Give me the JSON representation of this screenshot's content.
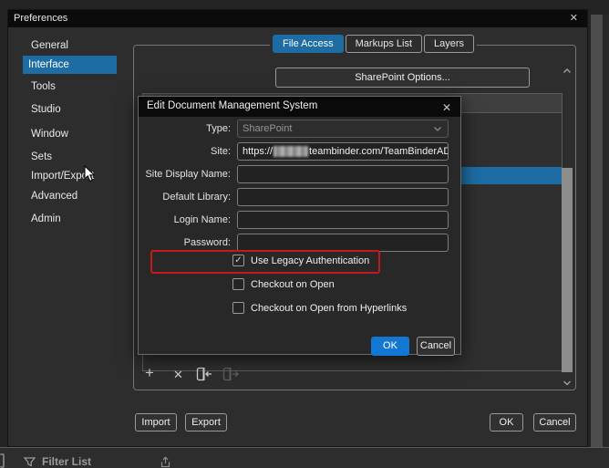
{
  "background_app": {
    "filter_list_label": "Filter List"
  },
  "window": {
    "title": "Preferences",
    "close_glyph": "✕"
  },
  "sidebar": {
    "selected": "Interface",
    "items": [
      "General",
      "Interface",
      "Tools",
      "Studio",
      "Window",
      "Sets",
      "Import/Export",
      "Advanced",
      "Admin"
    ]
  },
  "tabs": {
    "selected": "File Access",
    "items": [
      "File Access",
      "Markups List",
      "Layers"
    ]
  },
  "file_access": {
    "sharepoint_options_label": "SharePoint Options...",
    "list_toolbar": {
      "add_glyph": "+",
      "delete_glyph": "✕"
    }
  },
  "dms_dialog": {
    "title": "Edit Document Management System",
    "close_glyph": "✕",
    "check_glyph": "✓",
    "fields": [
      {
        "label": "Type:",
        "value": "SharePoint",
        "control": "select",
        "disabled": true
      },
      {
        "label": "Site:",
        "value_prefix": "https://",
        "value_redacted": true,
        "value_suffix": "teambinder.com/TeamBinderADFS/P...",
        "control": "input"
      },
      {
        "label": "Site Display Name:",
        "value": "",
        "control": "input"
      },
      {
        "label": "Default Library:",
        "value": "",
        "control": "input"
      },
      {
        "label": "Login Name:",
        "value": "",
        "control": "input"
      },
      {
        "label": "Password:",
        "value": "",
        "control": "input"
      }
    ],
    "checkboxes": [
      {
        "label": "Use Legacy Authentication",
        "checked": true,
        "annotated": true
      },
      {
        "label": "Checkout on Open",
        "checked": false
      },
      {
        "label": "Checkout on Open from Hyperlinks",
        "checked": false
      }
    ],
    "ok_label": "OK",
    "cancel_label": "Cancel"
  },
  "footer": {
    "import_label": "Import",
    "export_label": "Export",
    "ok_label": "OK",
    "cancel_label": "Cancel"
  },
  "colors": {
    "accent_blue": "#1d6ca3",
    "primary_button_blue": "#1377d4",
    "annotation_red": "#c51a1a",
    "window_bg": "#2d2d2d",
    "titlebar_bg": "#0b0b0b"
  }
}
